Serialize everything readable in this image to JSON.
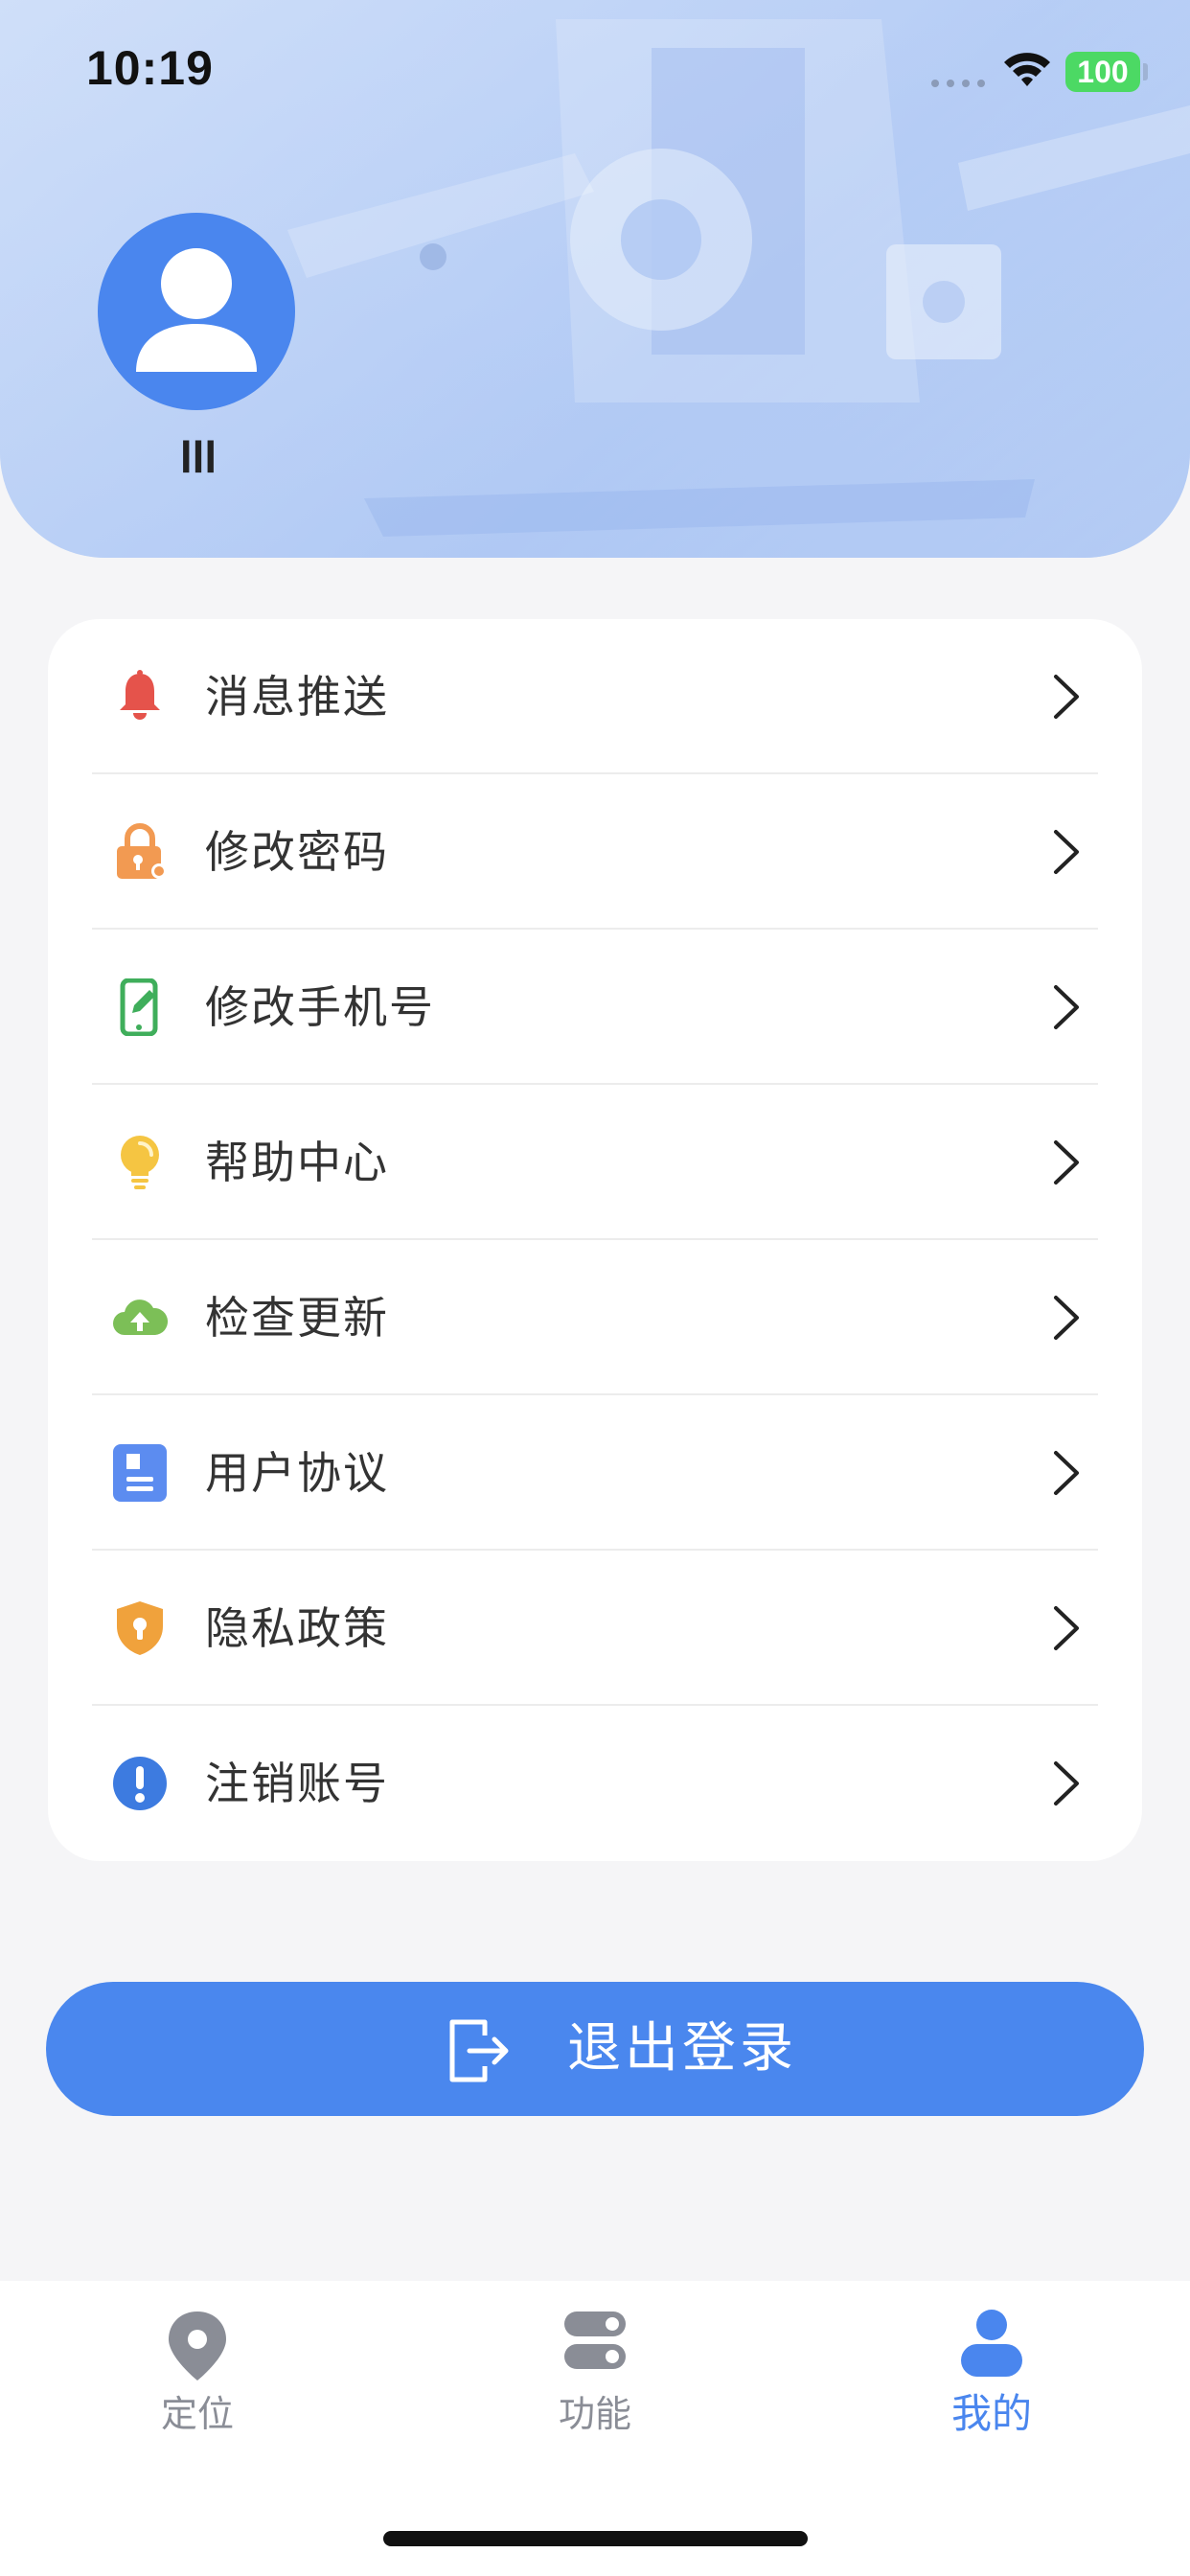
{
  "status_bar": {
    "time": "10:19",
    "battery": "100"
  },
  "profile": {
    "avatar_icon": "user-avatar-icon",
    "username": "lll"
  },
  "menu": {
    "items": [
      {
        "label": "消息推送",
        "icon": "bell-icon",
        "color": "#e5534b"
      },
      {
        "label": "修改密码",
        "icon": "lock-icon",
        "color": "#f29a52"
      },
      {
        "label": "修改手机号",
        "icon": "phone-edit-icon",
        "color": "#3fae5b"
      },
      {
        "label": "帮助中心",
        "icon": "lightbulb-icon",
        "color": "#f5c542"
      },
      {
        "label": "检查更新",
        "icon": "cloud-upload-icon",
        "color": "#7cbf57"
      },
      {
        "label": "用户协议",
        "icon": "document-icon",
        "color": "#5c8cf0"
      },
      {
        "label": "隐私政策",
        "icon": "shield-icon",
        "color": "#f0a23c"
      },
      {
        "label": "注销账号",
        "icon": "alert-icon",
        "color": "#3d7be0"
      }
    ]
  },
  "logout": {
    "label": "退出登录",
    "color": "#4a87ee"
  },
  "tabbar": {
    "tabs": [
      {
        "label": "定位",
        "icon": "location-pin-icon",
        "active": false
      },
      {
        "label": "功能",
        "icon": "toggles-icon",
        "active": false
      },
      {
        "label": "我的",
        "icon": "person-icon",
        "active": true
      }
    ]
  }
}
